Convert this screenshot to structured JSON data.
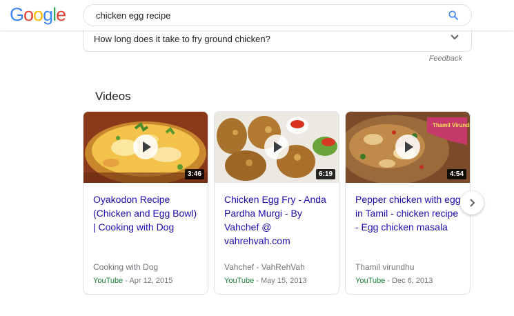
{
  "header": {
    "logo_letters": [
      "G",
      "o",
      "o",
      "g",
      "l",
      "e"
    ],
    "search_query": "chicken egg recipe"
  },
  "faq": {
    "question": "How long does it take to fry ground chicken?"
  },
  "feedback_label": "Feedback",
  "videos": {
    "section_title": "Videos",
    "items": [
      {
        "title": "Oyakodon Recipe (Chicken and Egg Bowl) | Cooking with Dog",
        "duration": "3:46",
        "channel": "Cooking with Dog",
        "source": "YouTube",
        "date": "- Apr 12, 2015"
      },
      {
        "title": "Chicken Egg Fry - Anda Pardha Murgi - By Vahchef @ vahrehvah.com",
        "duration": "6:19",
        "channel": "Vahchef - VahRehVah",
        "source": "YouTube",
        "date": "- May 15, 2013"
      },
      {
        "title": "Pepper chicken with egg in Tamil - chicken recipe - Egg chicken masala",
        "duration": "4:54",
        "channel": "Thamil virundhu",
        "source": "YouTube",
        "date": "- Dec 6, 2013",
        "thumb_overlay": "Thamil Virundhu"
      }
    ]
  },
  "colors": {
    "link": "#1a0dab",
    "source": "#188038",
    "meta": "#70757a",
    "accent": "#4285f4"
  },
  "icons": {
    "search": "search-icon",
    "faq": "chevron-down-icon",
    "next": "chevron-right-icon",
    "play": "play-icon"
  }
}
